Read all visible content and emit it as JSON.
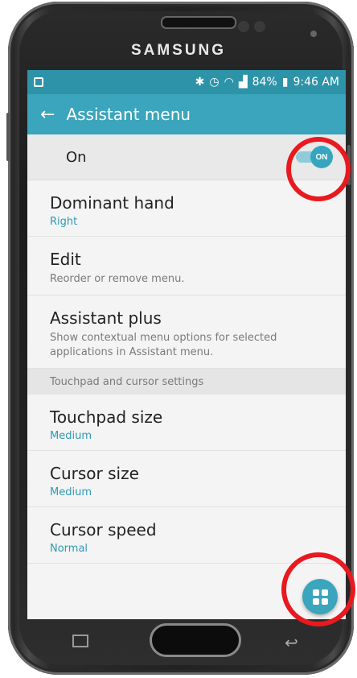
{
  "device": {
    "brand": "SAMSUNG"
  },
  "statusbar": {
    "battery": "84%",
    "time": "9:46 AM"
  },
  "toolbar": {
    "back_glyph": "←",
    "title": "Assistant menu"
  },
  "master_switch": {
    "label": "On",
    "toggle_text": "ON",
    "state": true
  },
  "items": [
    {
      "title": "Dominant hand",
      "value": "Right"
    },
    {
      "title": "Edit",
      "description": "Reorder or remove menu."
    },
    {
      "title": "Assistant plus",
      "description": "Show contextual menu options for selected applications in Assistant menu."
    }
  ],
  "section_header": "Touchpad and cursor settings",
  "touchpad_items": [
    {
      "title": "Touchpad size",
      "value": "Medium"
    },
    {
      "title": "Cursor size",
      "value": "Medium"
    },
    {
      "title": "Cursor speed",
      "value": "Normal"
    }
  ],
  "colors": {
    "accent": "#3aa5bc",
    "statusbar": "#2d93a8",
    "highlight_ring": "#e8191f"
  },
  "icons": {
    "back": "back-arrow-icon",
    "fab": "assistant-menu-grid-icon",
    "bluetooth": "bluetooth-icon",
    "wifi": "wifi-icon",
    "signal": "signal-icon",
    "battery": "battery-icon"
  }
}
